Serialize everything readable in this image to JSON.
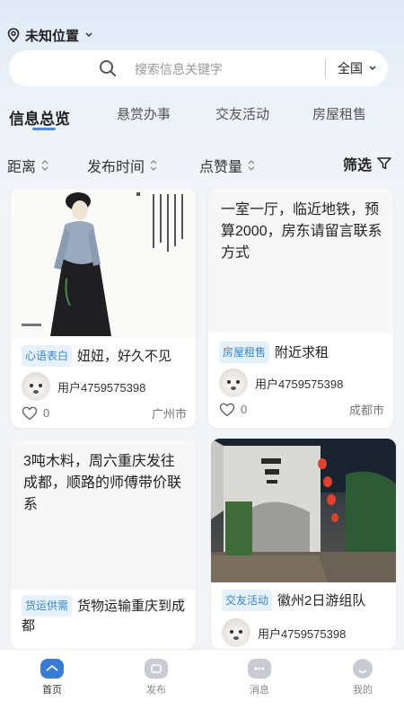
{
  "location": {
    "label": "未知位置"
  },
  "search": {
    "placeholder": "搜索信息关键字",
    "region": "全国"
  },
  "tabs": [
    "信息总览",
    "悬赏办事",
    "交友活动",
    "房屋租售"
  ],
  "sort": {
    "distance": "距离",
    "time": "发布时间",
    "likes": "点赞量",
    "filter": "筛选"
  },
  "cards": [
    {
      "tag": "心语表白",
      "title": "妞妞，好久不见",
      "user": "用户4759575398",
      "likes": "0",
      "city": "广州市"
    },
    {
      "text": "一室一厅，临近地铁，预算2000，房东请留言联系方式",
      "tag": "房屋租售",
      "title": "附近求租",
      "user": "用户4759575398",
      "likes": "0",
      "city": "成都市"
    },
    {
      "text": "3吨木料，周六重庆发往成都，顺路的师傅带价联系",
      "tag": "货运供需",
      "title": "货物运输重庆到成都",
      "user": "用户4759575398"
    },
    {
      "tag": "交友活动",
      "title": "徽州2日游组队",
      "user": "用户4759575398"
    }
  ],
  "nav": [
    "首页",
    "发布",
    "消息",
    "我的"
  ],
  "colors": {
    "accent": "#4a90e2",
    "tag_bg": "#e6f1fb",
    "tag_text": "#3a86c8"
  }
}
